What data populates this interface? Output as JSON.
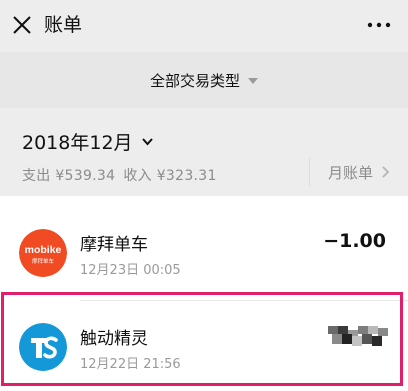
{
  "header": {
    "title": "账单",
    "close_icon": "close-icon",
    "more_icon": "more-icon"
  },
  "filter": {
    "label": "全部交易类型",
    "caret_icon": "caret-down-icon"
  },
  "month": {
    "label": "2018年12月",
    "expense_text": "支出 ¥539.34",
    "income_text": "收入 ¥323.31",
    "monthly_bill_label": "月账单"
  },
  "transactions": [
    {
      "merchant": "摩拜单车",
      "datetime": "12月23日 00:05",
      "amount": "−1.00",
      "logo_text": "mobike",
      "logo_subtext": "摩拜单车",
      "logo_color": "#f04b22"
    },
    {
      "merchant": "触动精灵",
      "datetime": "12月22日 21:56",
      "amount_obscured": true,
      "logo_color": "#1598d8"
    }
  ],
  "colors": {
    "background": "#ededed",
    "highlight": "#e01e69",
    "secondary_text": "#8c8c8c"
  }
}
